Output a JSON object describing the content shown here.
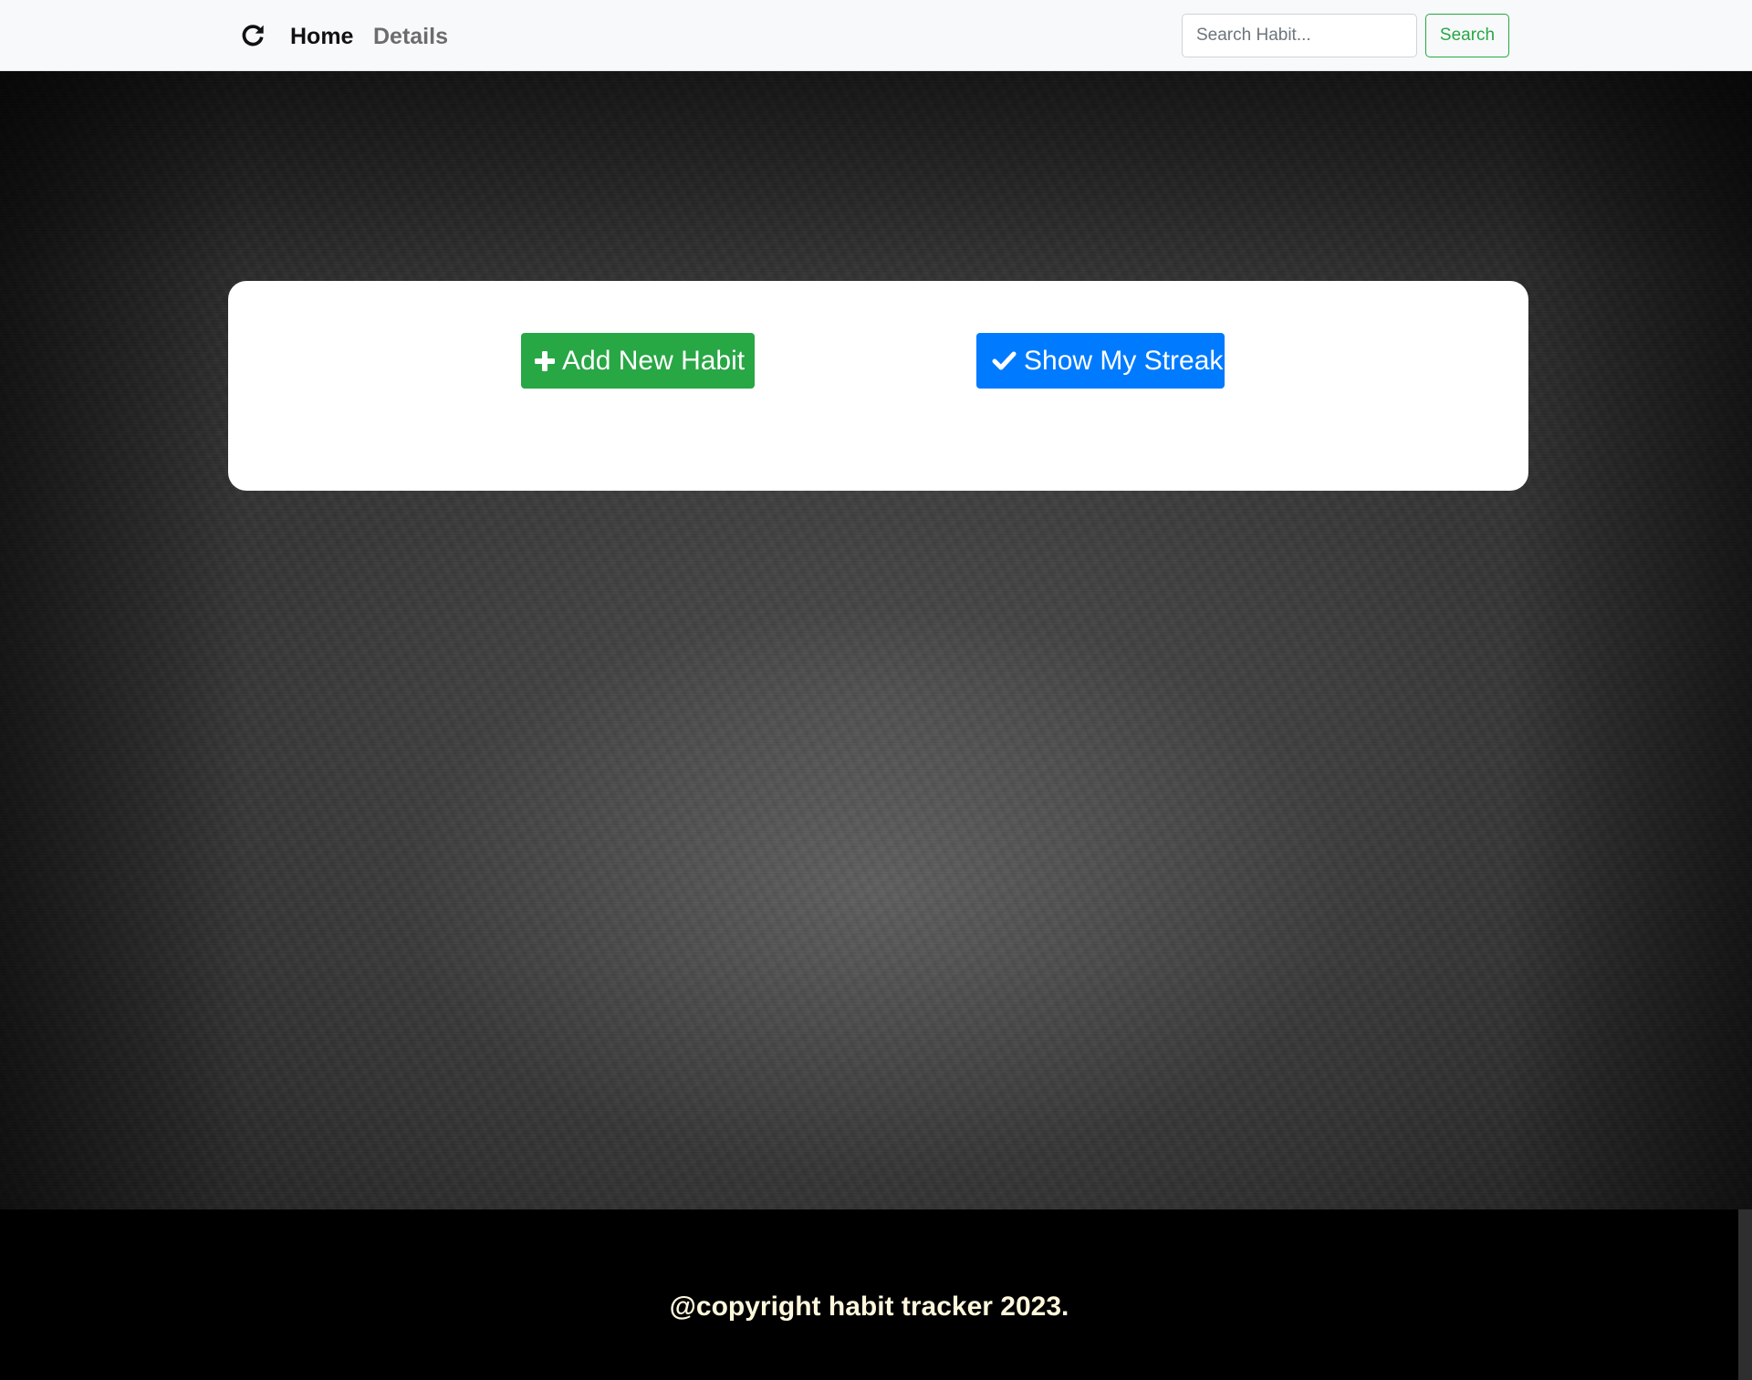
{
  "navbar": {
    "brand_icon": "refresh-icon",
    "links": [
      {
        "label": "Home",
        "active": true
      },
      {
        "label": "Details",
        "active": false
      }
    ],
    "search": {
      "placeholder": "Search Habit...",
      "value": "",
      "button_label": "Search"
    }
  },
  "main": {
    "add_button": {
      "icon": "plus-icon",
      "label": "Add New Habit"
    },
    "streak_button": {
      "icon": "check-icon",
      "label": "Show My Streak"
    }
  },
  "footer": {
    "text": "@copyright habit tracker 2023."
  },
  "colors": {
    "success": "#28a745",
    "primary": "#007bff",
    "navbar_bg": "#f8f9fa",
    "footer_bg": "#000000",
    "footer_text": "#fff8dc"
  }
}
